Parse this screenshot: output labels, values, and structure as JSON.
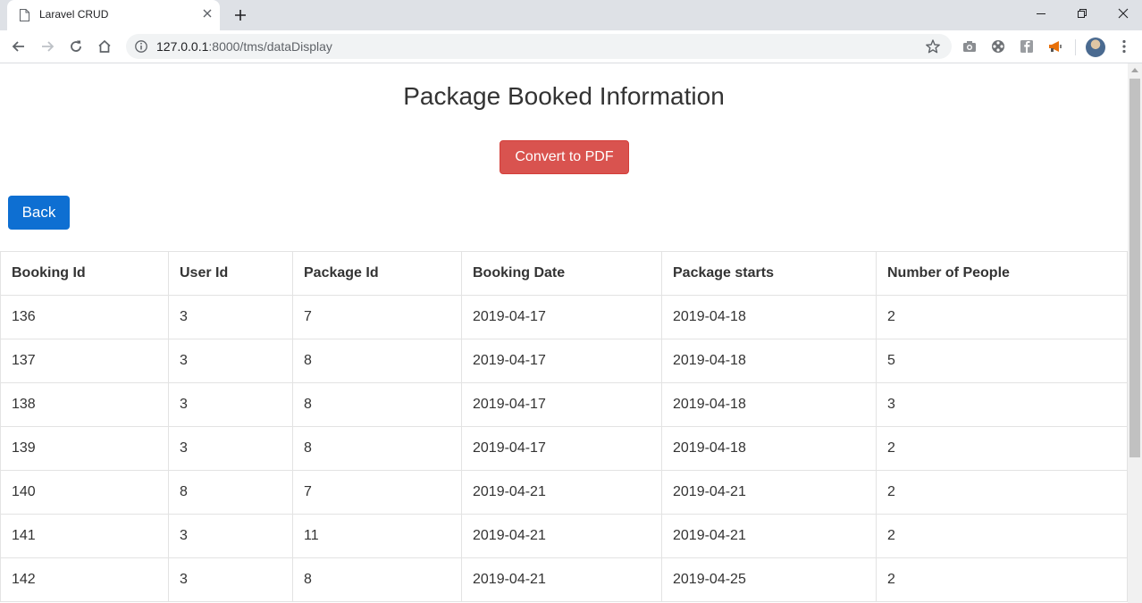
{
  "browser": {
    "tab_title": "Laravel CRUD",
    "url_host": "127.0.0.1",
    "url_rest": ":8000/tms/dataDisplay"
  },
  "page": {
    "title": "Package Booked Information",
    "pdf_button": "Convert to PDF",
    "back_button": "Back"
  },
  "table": {
    "headers": [
      "Booking Id",
      "User Id",
      "Package Id",
      "Booking Date",
      "Package starts",
      "Number of People"
    ],
    "rows": [
      [
        "136",
        "3",
        "7",
        "2019-04-17",
        "2019-04-18",
        "2"
      ],
      [
        "137",
        "3",
        "8",
        "2019-04-17",
        "2019-04-18",
        "5"
      ],
      [
        "138",
        "3",
        "8",
        "2019-04-17",
        "2019-04-18",
        "3"
      ],
      [
        "139",
        "3",
        "8",
        "2019-04-17",
        "2019-04-18",
        "2"
      ],
      [
        "140",
        "8",
        "7",
        "2019-04-21",
        "2019-04-21",
        "2"
      ],
      [
        "141",
        "3",
        "11",
        "2019-04-21",
        "2019-04-21",
        "2"
      ],
      [
        "142",
        "3",
        "8",
        "2019-04-21",
        "2019-04-25",
        "2"
      ]
    ]
  },
  "colors": {
    "danger": "#d9534f",
    "primary": "#0e6fd2"
  }
}
